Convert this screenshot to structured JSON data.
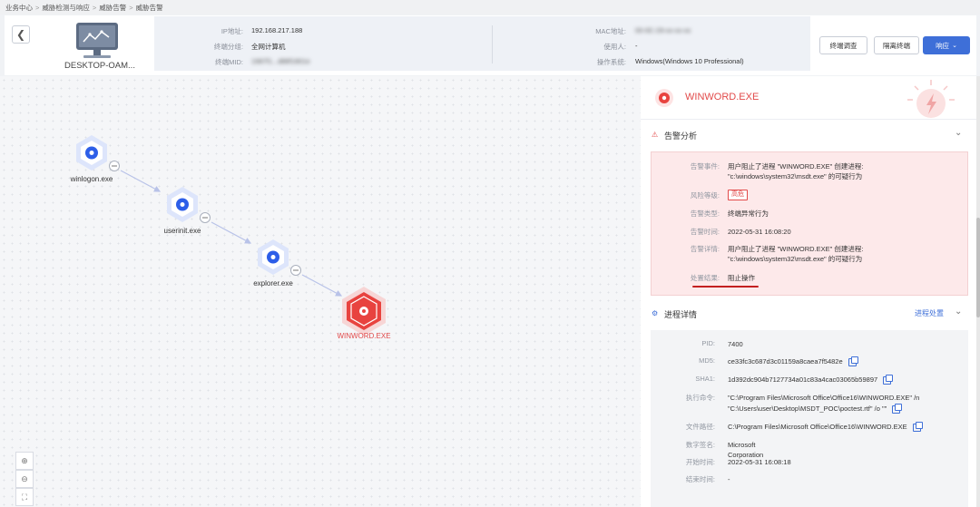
{
  "breadcrumb": [
    "业务中心",
    "威胁检测与响应",
    "威胁告警",
    "威胁告警"
  ],
  "host": {
    "name": "DESKTOP-OAM...",
    "ip_label": "IP地址:",
    "ip": "192.168.217.188",
    "group_label": "终端分组:",
    "group": "全网计算机",
    "mid_label": "终端MID:",
    "mid": "1987f1...d88f1801e",
    "mac_label": "MAC地址:",
    "mac": "00-0C-29-xx-xx-xx",
    "user_label": "使用人:",
    "user": "-",
    "os_label": "操作系统:",
    "os": "Windows(Windows 10 Professional)"
  },
  "actions": {
    "investigate": "终端调查",
    "isolate": "隔离终端",
    "respond": "响应"
  },
  "graph": {
    "nodes": [
      "winlogon.exe",
      "userinit.exe",
      "explorer.exe",
      "WINWORD.EXE"
    ],
    "collapse_symbol": "−"
  },
  "zoom": {
    "in": "⊕",
    "out": "⊖",
    "fit": "⛶"
  },
  "panel": {
    "title": "WINWORD.EXE",
    "alert_section": "告警分析",
    "alert": {
      "event_label": "告警事件:",
      "event": "用户阻止了进程 \"WINWORD.EXE\" 创建进程: \"c:\\windows\\system32\\msdt.exe\" 的可疑行为",
      "risk_label": "风险等级:",
      "risk": "高危",
      "type_label": "告警类型:",
      "type": "终端异常行为",
      "time_label": "告警时间:",
      "time": "2022-05-31 16:08:20",
      "detail_label": "告警详情:",
      "detail": "用户阻止了进程 \"WINWORD.EXE\" 创建进程: \"c:\\windows\\system32\\msdt.exe\" 的可疑行为",
      "result_label": "处置结果:",
      "result": "阻止操作"
    },
    "process_section": "进程详情",
    "process_link": "进程处置",
    "process": {
      "pid_label": "PID:",
      "pid": "7400",
      "md5_label": "MD5:",
      "md5": "ce33fc3c687d3c01159a8caea7f5482e",
      "sha1_label": "SHA1:",
      "sha1": "1d392dc904b7127734a01c83a4cac03065b59897",
      "cmd_label": "执行命令:",
      "cmd_line1": "\"C:\\Program Files\\Microsoft Office\\Office16\\WINWORD.EXE\" /n",
      "cmd_line2": "\"C:\\Users\\user\\Desktop\\MSDT_POC\\poctest.rtf\" /o \"\"",
      "path_label": "文件路径:",
      "path": "C:\\Program Files\\Microsoft Office\\Office16\\WINWORD.EXE",
      "sig_label": "数字签名:",
      "sig": "Microsoft Corporation",
      "start_label": "开始时间:",
      "start": "2022-05-31 16:08:18",
      "end_label": "结束时间:",
      "end": "-"
    }
  },
  "colors": {
    "accent": "#3e6fd8",
    "danger": "#e24a4a",
    "node": "#2d5ee8"
  }
}
